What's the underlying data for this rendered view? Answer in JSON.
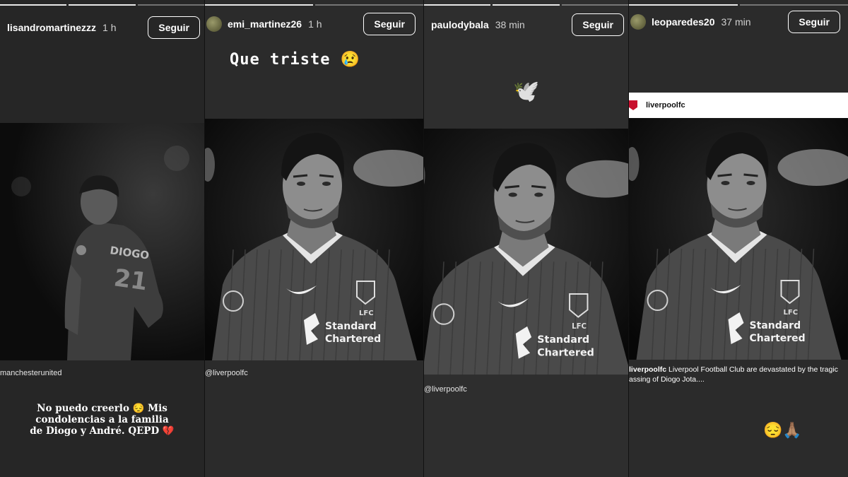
{
  "stories": [
    {
      "username": "lisandromartinezzz",
      "time": "1 h",
      "follow_label": "Seguir",
      "shared_handle": "manchesterunited",
      "text_lines": [
        "No puedo creerlo 😔 Mis",
        "condolencias a la familia",
        "de Diogo y André. QEPD 💔"
      ],
      "jersey_text": "DIOGO",
      "progress": [
        1,
        1,
        0
      ]
    },
    {
      "username": "emi_martinez26",
      "time": "1 h",
      "follow_label": "Seguir",
      "text": "Que triste 😢",
      "shared_handle": "liverpoolfc",
      "progress": [
        1,
        0
      ]
    },
    {
      "username": "paulodybala",
      "time": "38 min",
      "follow_label": "Seguir",
      "emoji": "🕊️",
      "shared_handle": "liverpoolfc",
      "progress": [
        1,
        1,
        0
      ]
    },
    {
      "username": "leoparedes20",
      "time": "37 min",
      "follow_label": "Seguir",
      "post_account": "liverpoolfc",
      "caption_account": "liverpoolfc",
      "caption_line1": "Liverpool Football Club are devastated by the tragic",
      "caption_line2": "assing of Diogo Jota....",
      "emojis": "😔🙏🏽",
      "progress": [
        1,
        0
      ]
    }
  ],
  "jersey": {
    "sponsor_line1": "Standard",
    "sponsor_line2": "Chartered",
    "club": "LFC"
  },
  "icons": [
    "avatar",
    "nike-swoosh-icon",
    "liverbird-crest-icon",
    "dove-icon",
    "broken-heart-icon"
  ]
}
